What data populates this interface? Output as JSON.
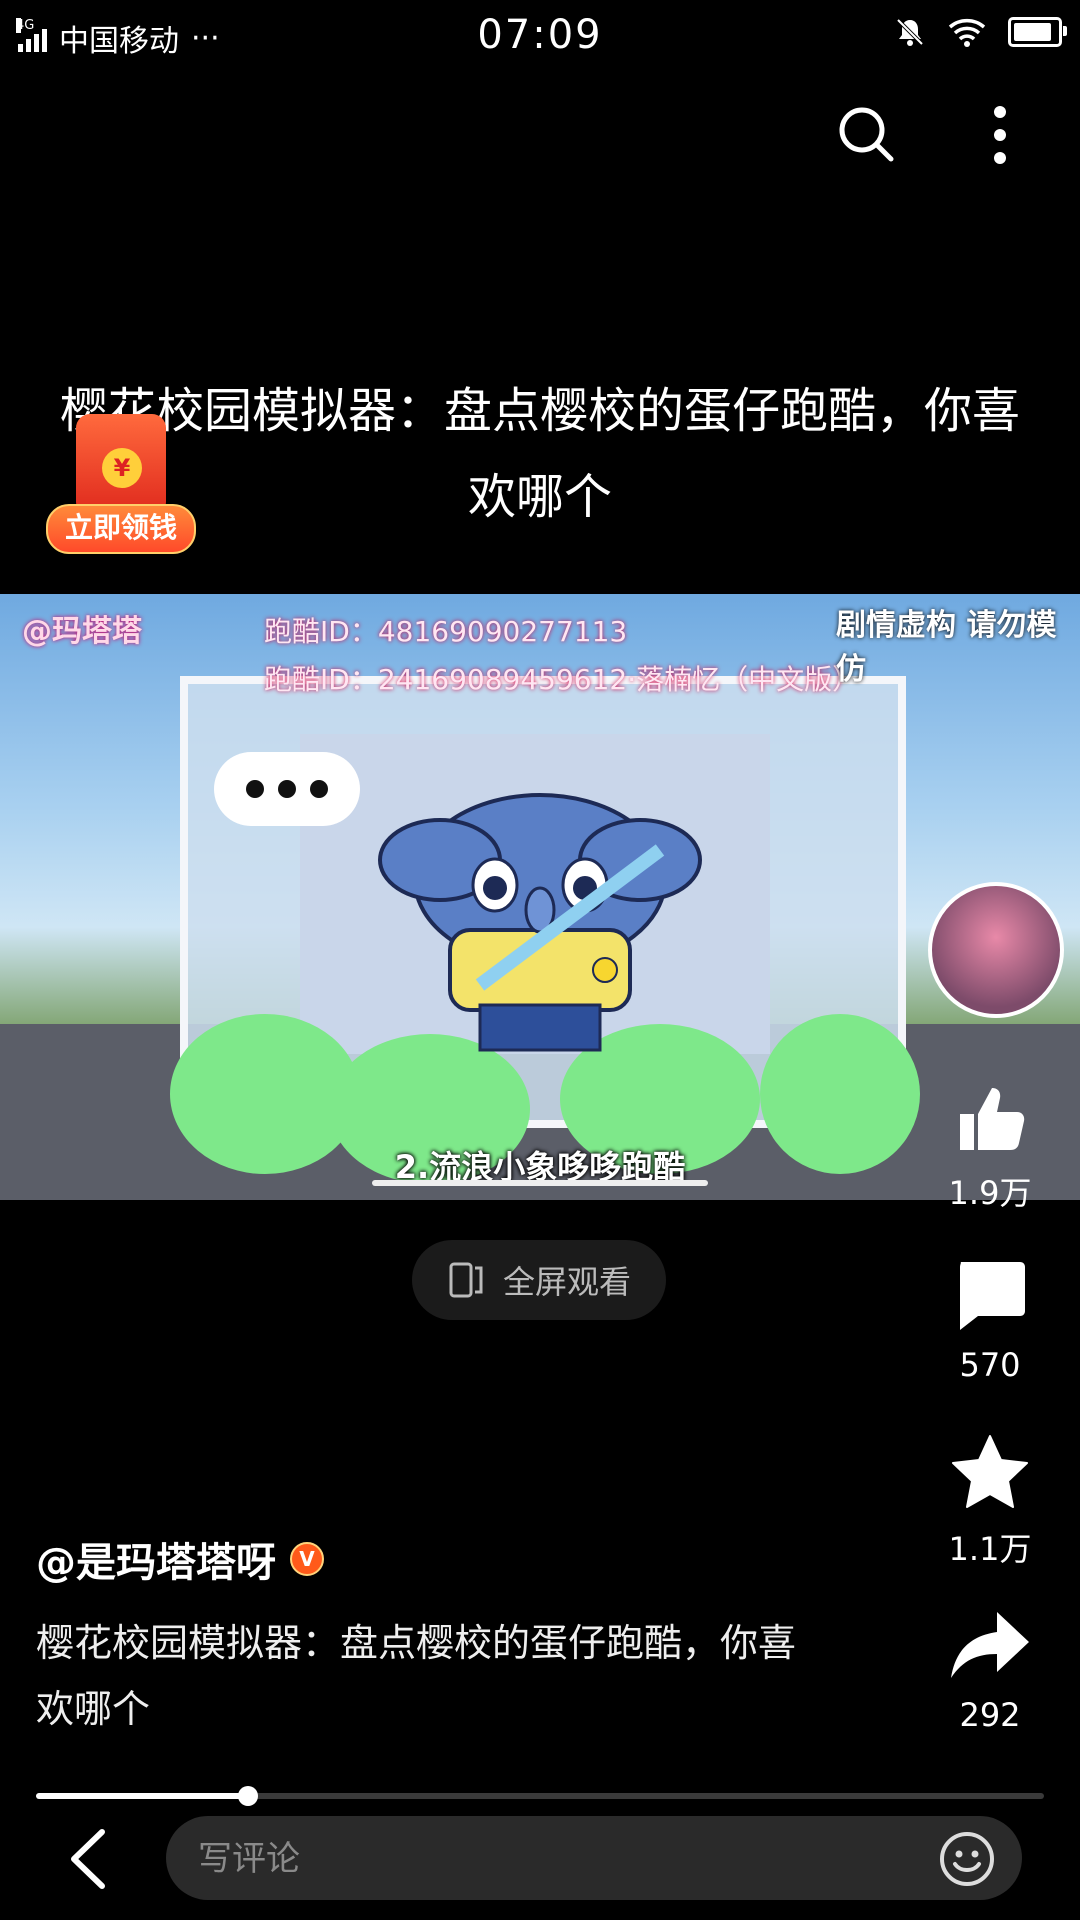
{
  "status_bar": {
    "network": "4G",
    "carrier": "中国移动",
    "more": "···",
    "time": "07:09",
    "battery_level": 0.9
  },
  "video": {
    "title": "樱花校园模拟器：盘点樱校的蛋仔跑酷，你喜欢哪个",
    "watermark": "@玛塔塔",
    "parkour_id_1": "跑酷ID：48169090277113",
    "parkour_id_2": "跑酷ID：24169089459612·落楠忆（中文版）",
    "disclaimer": "剧情虚构 请勿模仿",
    "caption": "2.流浪小象哆哆跑酷",
    "fullscreen_label": "全屏观看"
  },
  "promo": {
    "label": "立即领钱",
    "coin_symbol": "¥"
  },
  "actions": {
    "like_count": "1.9万",
    "comment_count": "570",
    "favorite_count": "1.1万",
    "share_count": "292"
  },
  "author": {
    "name": "@是玛塔塔呀",
    "badge": "V"
  },
  "description": "樱花校园模拟器：盘点樱校的蛋仔跑酷，你喜欢哪个",
  "playback": {
    "progress": 0.21
  },
  "comment_bar": {
    "placeholder": "写评论"
  },
  "colors": {
    "background": "#000000",
    "badge": "#ff5a1a",
    "input_bg": "#2a2a2a"
  }
}
